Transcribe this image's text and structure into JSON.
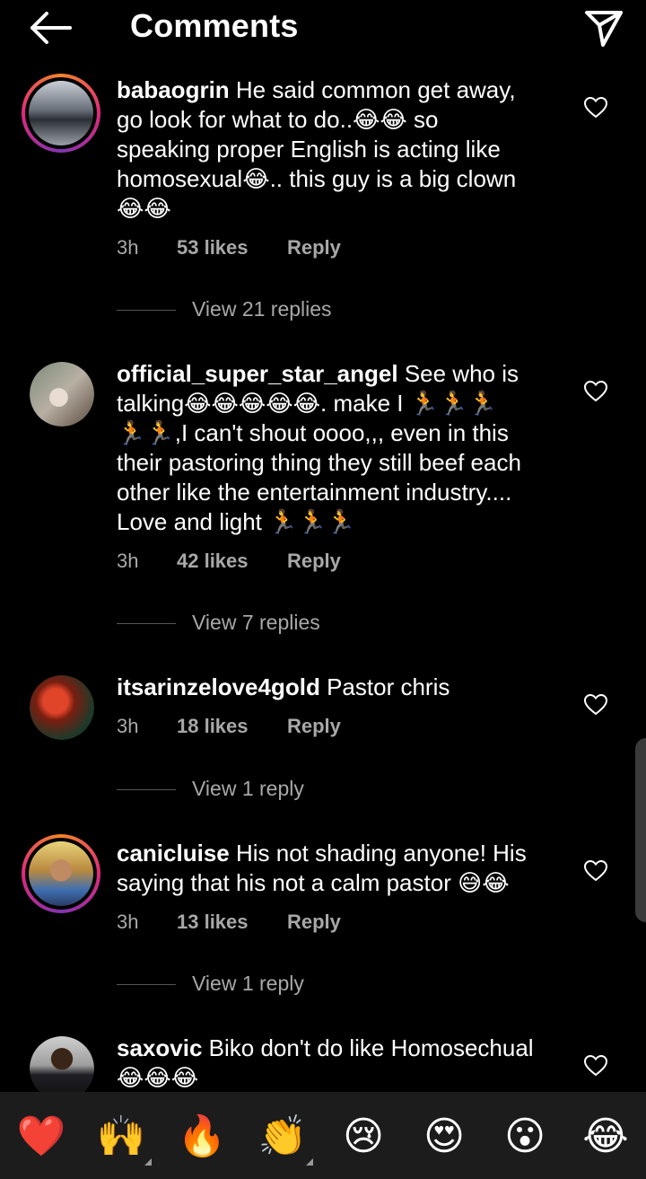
{
  "header": {
    "title": "Comments"
  },
  "comments": [
    {
      "username": "babaogrin",
      "lines": [
        "He said common get away,",
        "go look for what to do..😂😂 so",
        "speaking proper English is acting like",
        "homosexual😂.. this guy is a big clown",
        "😂😂"
      ],
      "time": "3h",
      "likes": "53 likes",
      "reply": "Reply",
      "replies": "View 21 replies"
    },
    {
      "username": "official_super_star_angel",
      "lines": [
        "See who is",
        "talking😂😂😂😂😂. make I 🏃🏃🏃",
        "🏃🏃,I can't shout oooo,,, even in this",
        "their pastoring thing they still beef each",
        "other like the entertainment industry....",
        "Love and light 🏃🏃🏃"
      ],
      "time": "3h",
      "likes": "42 likes",
      "reply": "Reply",
      "replies": "View 7 replies"
    },
    {
      "username": "itsarinzelove4gold",
      "lines": [
        "Pastor chris"
      ],
      "time": "3h",
      "likes": "18 likes",
      "reply": "Reply",
      "replies": "View 1 reply"
    },
    {
      "username": "canicluise",
      "lines": [
        "His not shading anyone! His",
        "saying that his not a calm pastor 😅😂"
      ],
      "time": "3h",
      "likes": "13 likes",
      "reply": "Reply",
      "replies": "View 1 reply"
    },
    {
      "username": "saxovic",
      "lines": [
        "Biko don't do like Homosechual",
        "😂😂😂"
      ]
    }
  ],
  "reactions": [
    "❤️",
    "🙌",
    "🔥",
    "👏",
    "😢",
    "😍",
    "😮",
    "😂"
  ],
  "icons": {
    "back": "arrow-left-icon",
    "send": "paper-plane-icon",
    "like": "heart-outline-icon"
  },
  "colors": {
    "background": "#000000",
    "secondary_text": "#a8a8a8",
    "story_ring": "#dd2a7b"
  }
}
